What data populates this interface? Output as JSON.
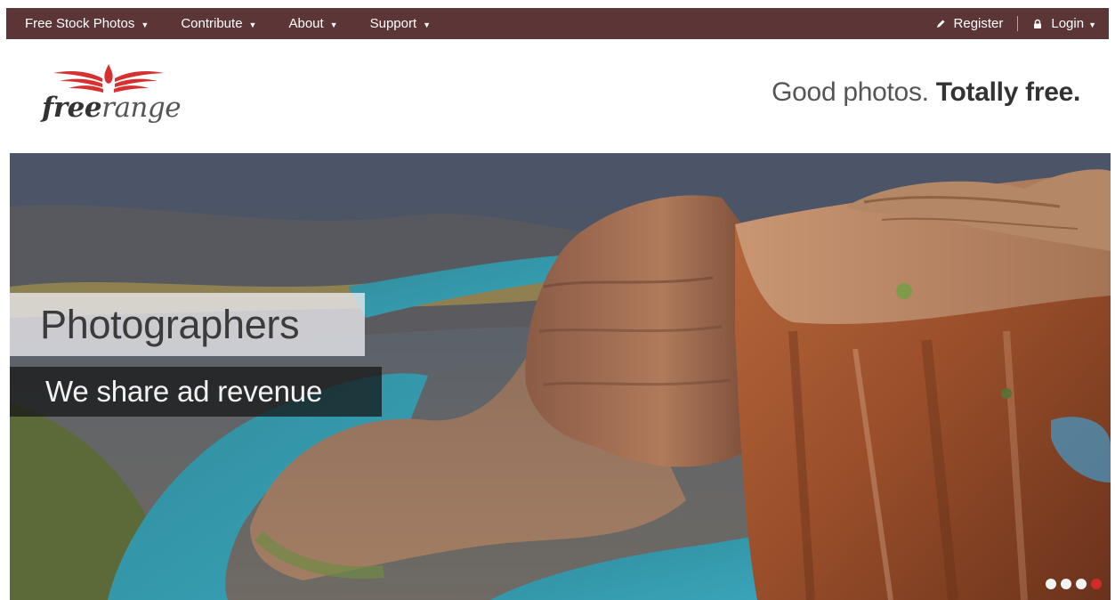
{
  "nav": {
    "left": [
      {
        "label": "Free Stock Photos"
      },
      {
        "label": "Contribute"
      },
      {
        "label": "About"
      },
      {
        "label": "Support"
      }
    ],
    "register": "Register",
    "login": "Login",
    "background": "#5c3537"
  },
  "logo": {
    "part1": "free",
    "part2": "range",
    "wing_color": "#d63030"
  },
  "tagline": {
    "light": "Good photos.",
    "bold": "Totally free."
  },
  "hero": {
    "title": "Photographers",
    "subtitle": "We share ad revenue",
    "slides": 4,
    "active_slide": 4,
    "active_dot_color": "#d22a2a"
  }
}
